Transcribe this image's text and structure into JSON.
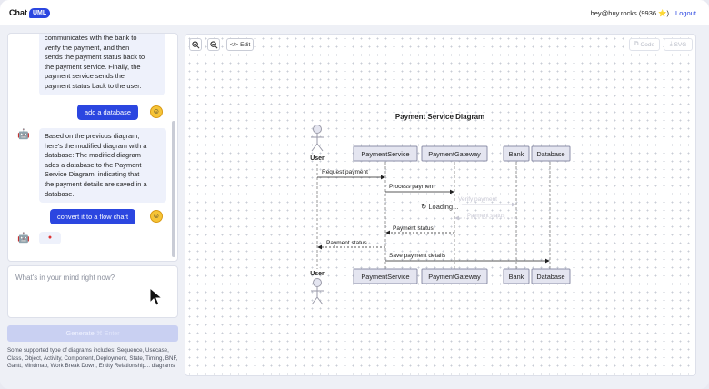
{
  "app": {
    "logo_text": "Chat",
    "logo_badge": "UML"
  },
  "header": {
    "user": "hey@huy.rocks (9936 ⭐)",
    "logout": "Logout"
  },
  "chat": {
    "bot_message_1": [
      "communicates with the bank to",
      "verify the payment, and then",
      "sends the payment status back to",
      "the payment service. Finally, the",
      "payment service sends the",
      "payment status back to the user."
    ],
    "user_message_1": "add a database",
    "bot_message_2": [
      "Based on the previous diagram,",
      "here's the modified diagram with a",
      "database: The modified diagram",
      "adds a database to the Payment",
      "Service Diagram, indicating that",
      "the payment details are saved in a",
      "database."
    ],
    "user_message_2": "convert it to a flow chart",
    "typing": "●"
  },
  "prompt": {
    "placeholder": "What's in your mind right now?"
  },
  "generate": {
    "label": "Generate",
    "shortcut": "⌘ Enter"
  },
  "support_text": "Some supported type of diagrams includes: Sequence, Usecase, Class, Object, Activity, Component, Deployment, State, Timing, BNF, Gantt, Mindmap, Work Break Down, Entity Relationship... diagrams",
  "toolbar": {
    "edit": "Edit",
    "code": "Code",
    "svg": "SVG"
  },
  "diagram": {
    "title": "Payment Service Diagram",
    "actor": "User",
    "participants": [
      "PaymentService",
      "PaymentGateway",
      "Bank",
      "Database"
    ],
    "messages": [
      "Request payment",
      "Process payment",
      "Verify payment",
      "Payment status",
      "Payment status",
      "Payment status",
      "Save payment details"
    ],
    "loading": "Loading..."
  },
  "colors": {
    "accent": "#2b46e0",
    "participant_fill": "#e4e5f0",
    "participant_border": "#8c8fa8"
  }
}
